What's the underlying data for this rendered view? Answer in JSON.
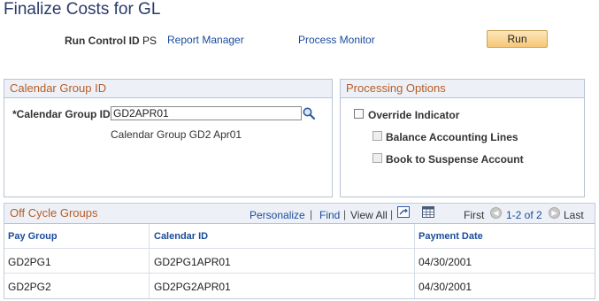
{
  "page": {
    "title": "Finalize Costs for GL"
  },
  "run_control": {
    "label": "Run Control ID",
    "value": "PS",
    "report_manager": "Report Manager",
    "process_monitor": "Process Monitor",
    "run_button": "Run"
  },
  "calendar_group": {
    "header": "Calendar Group ID",
    "field_label": "*Calendar Group ID",
    "field_value": "GD2APR01",
    "description": "Calendar Group GD2 Apr01",
    "search_icon": "magnifier-icon"
  },
  "processing_options": {
    "header": "Processing Options",
    "override": {
      "label": "Override Indicator",
      "checked": false
    },
    "balance": {
      "label": "Balance Accounting Lines",
      "checked": false,
      "disabled": true
    },
    "suspense": {
      "label": "Book to Suspense Account",
      "checked": false,
      "disabled": true
    }
  },
  "off_cycle": {
    "header": "Off Cycle Groups",
    "toolbar": {
      "personalize": "Personalize",
      "sep1": "|",
      "find": "Find",
      "sep2": "|",
      "view_all": "View All",
      "sep3": "|",
      "zoom_icon": "zoom-grid-icon",
      "download_icon": "spreadsheet-icon",
      "first": "First",
      "range": "1-2 of 2",
      "last": "Last"
    },
    "columns": [
      "Pay Group",
      "Calendar ID",
      "Payment Date"
    ],
    "rows": [
      [
        "GD2PG1",
        "GD2PG1APR01",
        "04/30/2001"
      ],
      [
        "GD2PG2",
        "GD2PG2APR01",
        "04/30/2001"
      ]
    ]
  },
  "colors": {
    "title": "#2a3a6a",
    "link": "#1a4b9b",
    "section_header_text": "#b75c25",
    "section_header_bg": "#edf1f7",
    "button_bg": "#f6c878"
  }
}
